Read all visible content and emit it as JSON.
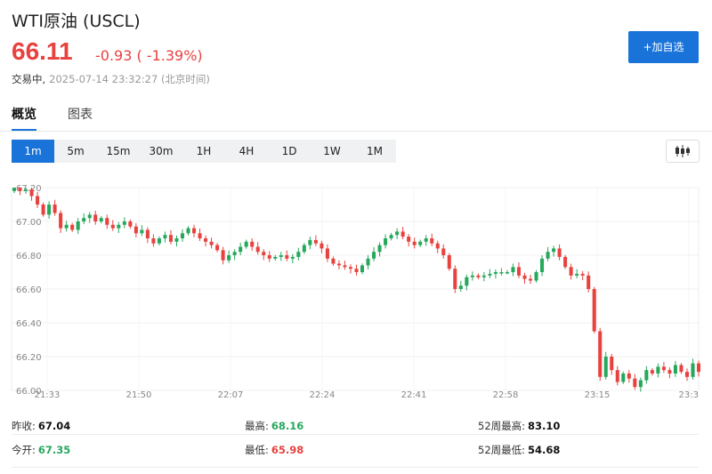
{
  "header": {
    "title": "WTI原油 (USCL)",
    "price": "66.11",
    "change": "-0.93 ( -1.39%)",
    "status": "交易中,",
    "timestamp": "2025-07-14 23:32:27 (北京时间)",
    "add_button": "+加自选"
  },
  "tabs": [
    {
      "label": "概览",
      "active": true
    },
    {
      "label": "图表",
      "active": false
    }
  ],
  "periods": [
    {
      "label": "1m",
      "active": true
    },
    {
      "label": "5m"
    },
    {
      "label": "15m"
    },
    {
      "label": "30m"
    },
    {
      "label": "1H"
    },
    {
      "label": "4H"
    },
    {
      "label": "1D"
    },
    {
      "label": "1W"
    },
    {
      "label": "1M"
    }
  ],
  "colors": {
    "up": "#26a85c",
    "down": "#e8423f",
    "accent": "#1a73d9"
  },
  "icons": {
    "chart_type": "candlestick-icon"
  },
  "stats": {
    "prev_close": {
      "label": "昨收:",
      "value": "67.04"
    },
    "open": {
      "label": "今开:",
      "value": "67.35"
    },
    "high": {
      "label": "最高:",
      "value": "68.16"
    },
    "low": {
      "label": "最低:",
      "value": "65.98"
    },
    "high52": {
      "label": "52周最高:",
      "value": "83.10"
    },
    "low52": {
      "label": "52周最低:",
      "value": "54.68"
    }
  },
  "chart_data": {
    "type": "candlestick",
    "interval": "1m",
    "ylim": [
      66.0,
      67.2
    ],
    "y_ticks": [
      "67.20",
      "67.00",
      "66.80",
      "66.60",
      "66.40",
      "66.20",
      "66.00"
    ],
    "x_ticks": [
      "21:33",
      "21:50",
      "22:07",
      "22:24",
      "22:41",
      "22:58",
      "23:15",
      "23:3"
    ],
    "grid": true,
    "close_series": [
      67.2,
      67.18,
      67.19,
      67.15,
      67.1,
      67.04,
      67.1,
      67.05,
      66.96,
      66.98,
      66.95,
      67.0,
      67.02,
      67.04,
      67.0,
      67.02,
      66.98,
      66.96,
      66.98,
      67.0,
      66.97,
      66.93,
      66.95,
      66.9,
      66.87,
      66.9,
      66.92,
      66.88,
      66.9,
      66.93,
      66.96,
      66.93,
      66.9,
      66.88,
      66.86,
      66.83,
      66.77,
      66.8,
      66.82,
      66.85,
      66.88,
      66.85,
      66.82,
      66.8,
      66.78,
      66.79,
      66.8,
      66.78,
      66.79,
      66.82,
      66.86,
      66.89,
      66.87,
      66.84,
      66.78,
      66.75,
      66.74,
      66.73,
      66.72,
      66.7,
      66.74,
      66.78,
      66.82,
      66.86,
      66.9,
      66.92,
      66.94,
      66.91,
      66.88,
      66.86,
      66.88,
      66.9,
      66.87,
      66.84,
      66.8,
      66.72,
      66.6,
      66.62,
      66.67,
      66.68,
      66.67,
      66.68,
      66.69,
      66.7,
      66.7,
      66.7,
      66.73,
      66.68,
      66.66,
      66.65,
      66.7,
      66.78,
      66.82,
      66.84,
      66.79,
      66.73,
      66.68,
      66.69,
      66.68,
      66.6,
      66.35,
      66.08,
      66.2,
      66.12,
      66.05,
      66.1,
      66.07,
      66.02,
      66.06,
      66.12,
      66.1,
      66.14,
      66.12,
      66.1,
      66.15,
      66.11,
      66.08,
      66.16,
      66.11
    ]
  }
}
